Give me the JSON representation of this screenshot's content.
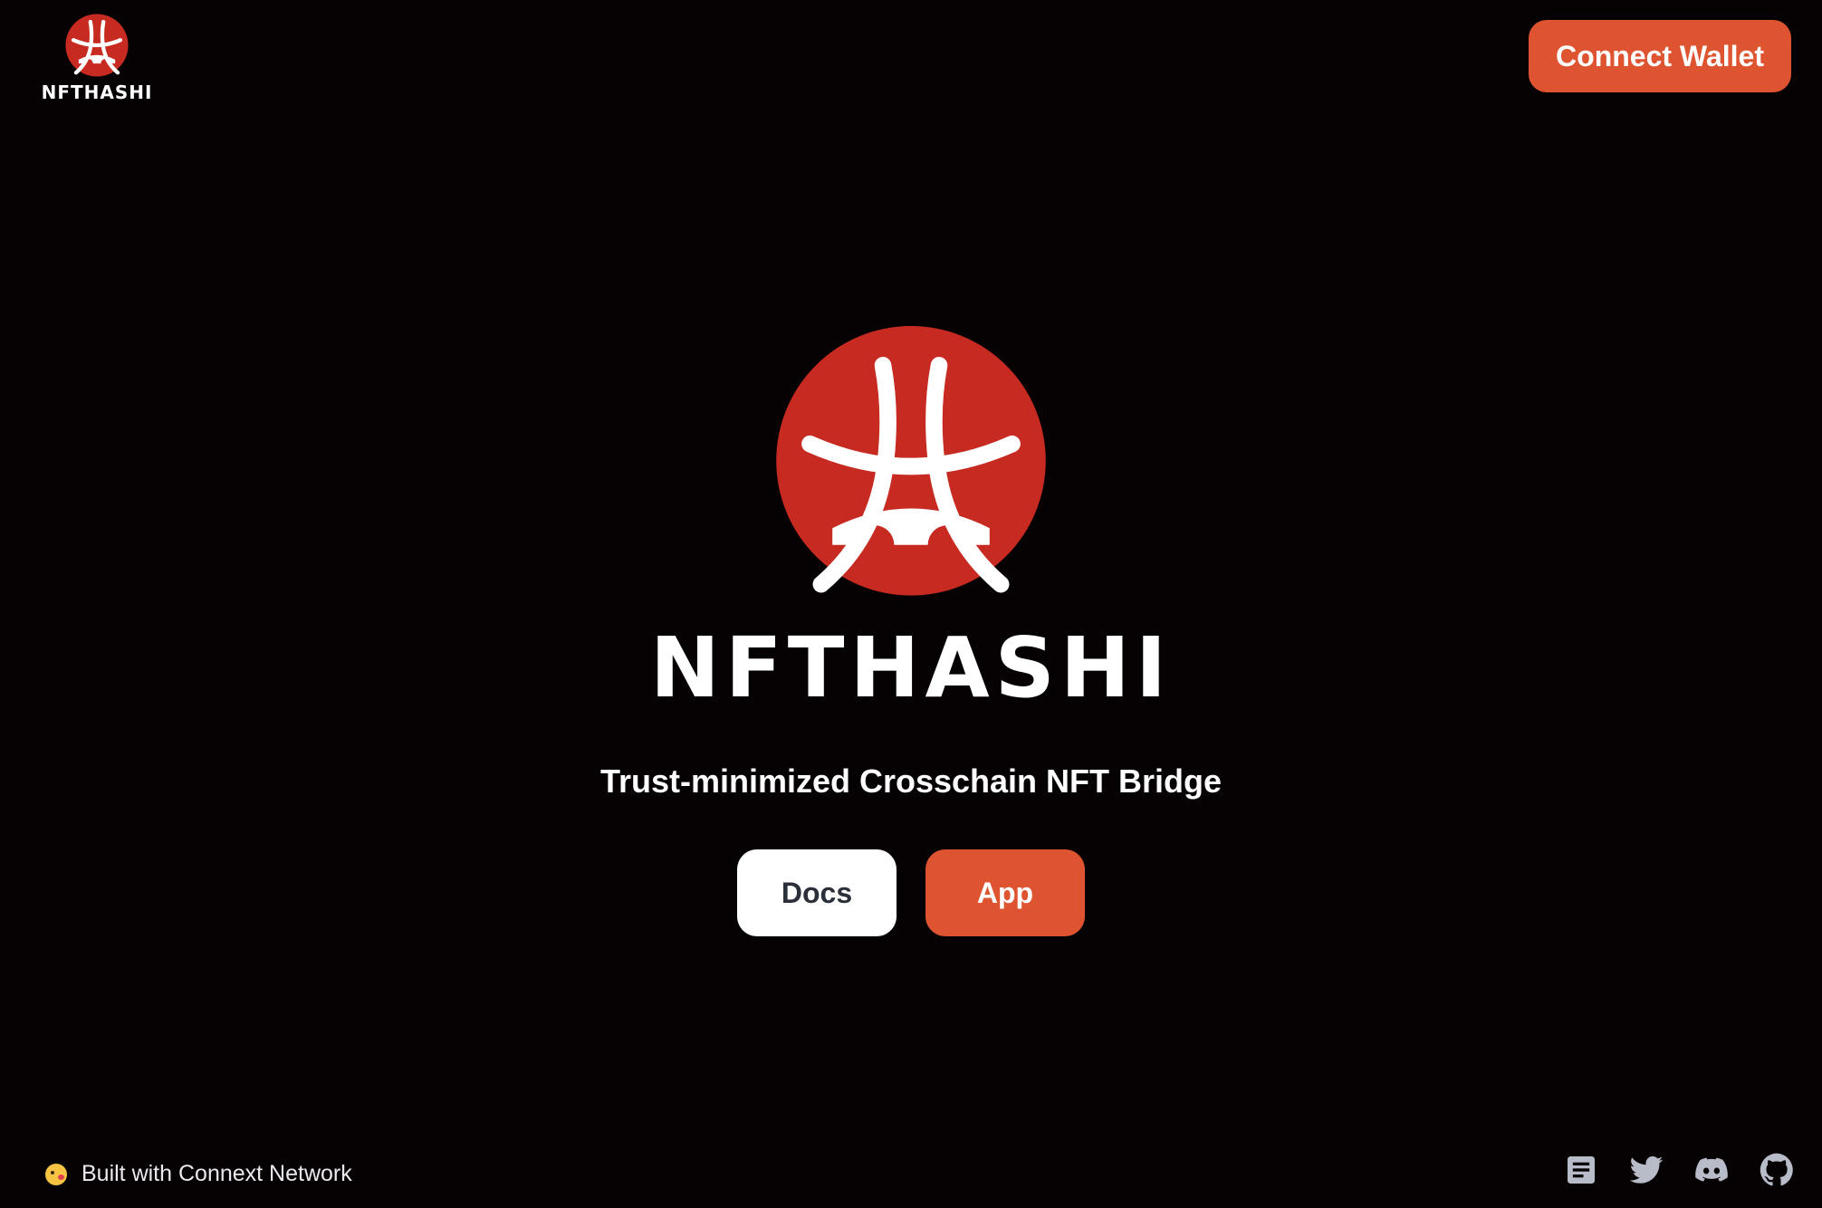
{
  "header": {
    "logo_text": "NFTHASHI",
    "connect_label": "Connect Wallet"
  },
  "hero": {
    "wordmark": "NFTHASHI",
    "tagline": "Trust-minimized Crosschain NFT Bridge",
    "docs_label": "Docs",
    "app_label": "App"
  },
  "footer": {
    "built_with": "Built with Connext Network",
    "icons": [
      "docs-icon",
      "twitter-icon",
      "discord-icon",
      "github-icon"
    ]
  },
  "colors": {
    "background": "#060204",
    "accent": "#de5430",
    "logo_red": "#c72a20",
    "icon_gray": "#b8bcc8"
  }
}
